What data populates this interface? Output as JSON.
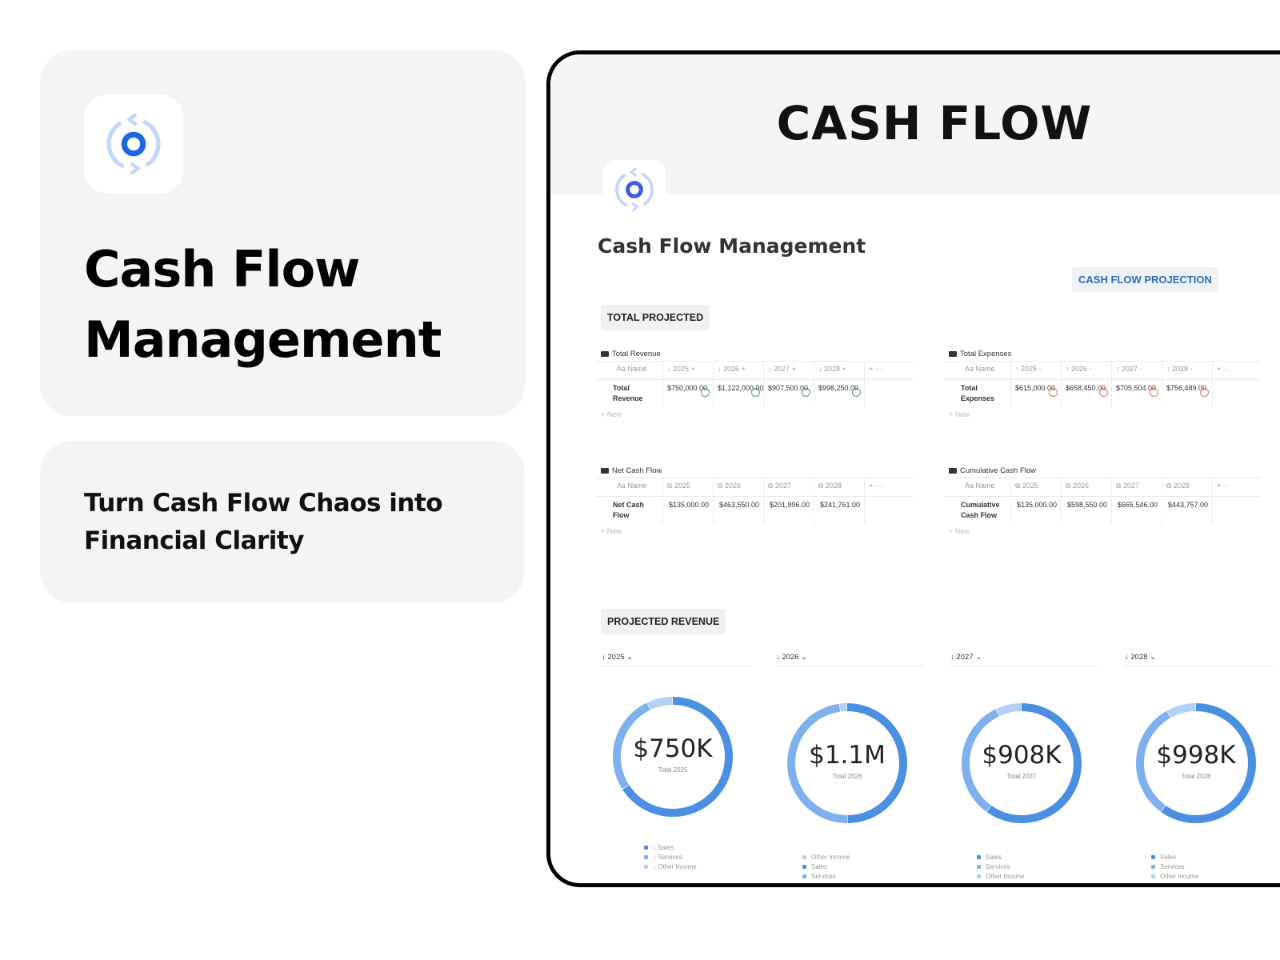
{
  "promo": {
    "title_line1": "Cash Flow",
    "title_line2": "Management",
    "tagline_line1": "Turn Cash Flow Chaos into",
    "tagline_line2": "Financial Clarity"
  },
  "page": {
    "cover_title": "CASH FLOW",
    "title": "Cash Flow Management",
    "projection_button": "CASH FLOW PROJECTION",
    "section_total": "TOTAL PROJECTED",
    "section_revenue": "PROJECTED REVENUE",
    "new_label": "New",
    "name_col": "Aa Name"
  },
  "colors": {
    "accent": "#2f6fb8",
    "sales": "#4a8fe2",
    "services": "#7fb0ee",
    "other_income": "#b3d0f6",
    "positive_ring": "#5a8f7a",
    "negative_ring": "#e0715e"
  },
  "tables": [
    {
      "title": "Total Revenue",
      "headers": [
        "2025 +",
        "2026 +",
        "2027 +",
        "2028 +"
      ],
      "header_icon": "arrow-down-icon",
      "row_name": "Total Revenue",
      "values": [
        "$750,000.00",
        "$1,122,000.00",
        "$907,500.00",
        "$998,250.00"
      ],
      "ring": "positive"
    },
    {
      "title": "Total Expenses",
      "headers": [
        "2025 -",
        "2026 -",
        "2027 -",
        "2028 -"
      ],
      "header_icon": "arrow-up-icon",
      "row_name": "Total Expenses",
      "values": [
        "$615,000.00",
        "$658,450.00",
        "$705,504.00",
        "$756,489.00"
      ],
      "ring": "negative"
    },
    {
      "title": "Net Cash Flow",
      "headers": [
        "2025",
        "2026",
        "2027",
        "2028"
      ],
      "header_icon": "formula-icon",
      "row_name": "Net Cash Flow",
      "values": [
        "$135,000.00",
        "$463,550.00",
        "$201,996.00",
        "$241,761.00"
      ]
    },
    {
      "title": "Cumulative Cash Flow",
      "headers": [
        "2025",
        "2026",
        "2027",
        "2028"
      ],
      "header_icon": "formula-icon",
      "row_name": "Cumulative Cash Flow",
      "values": [
        "$135,000.00",
        "$598,550.00",
        "$665,546.00",
        "$443,757.00"
      ]
    }
  ],
  "chart_data": [
    {
      "type": "pie",
      "year_selector": "2025",
      "center": "$750K",
      "caption": "Total 2025",
      "series": [
        {
          "name": "Sales",
          "fraction": 0.66
        },
        {
          "name": "Services",
          "fraction": 0.27
        },
        {
          "name": "Other Income",
          "fraction": 0.07
        }
      ],
      "legend": [
        "Sales",
        "Services",
        "Other Income"
      ]
    },
    {
      "type": "pie",
      "year_selector": "2026",
      "center": "$1.1M",
      "caption": "Total 2026",
      "series": [
        {
          "name": "Sales",
          "fraction": 0.5
        },
        {
          "name": "Services",
          "fraction": 0.48
        },
        {
          "name": "Other Income",
          "fraction": 0.02
        }
      ],
      "legend": [
        "Other Income",
        "Sales",
        "Services"
      ]
    },
    {
      "type": "pie",
      "year_selector": "2027",
      "center": "$908K",
      "caption": "Total 2027",
      "series": [
        {
          "name": "Sales",
          "fraction": 0.6
        },
        {
          "name": "Services",
          "fraction": 0.33
        },
        {
          "name": "Other Income",
          "fraction": 0.07
        }
      ],
      "legend": [
        "Sales",
        "Services",
        "Other Income"
      ]
    },
    {
      "type": "pie",
      "year_selector": "2028",
      "center": "$998K",
      "caption": "Total 2028",
      "series": [
        {
          "name": "Sales",
          "fraction": 0.6
        },
        {
          "name": "Services",
          "fraction": 0.32
        },
        {
          "name": "Other Income",
          "fraction": 0.08
        }
      ],
      "legend": [
        "Sales",
        "Services",
        "Other Income"
      ]
    }
  ]
}
